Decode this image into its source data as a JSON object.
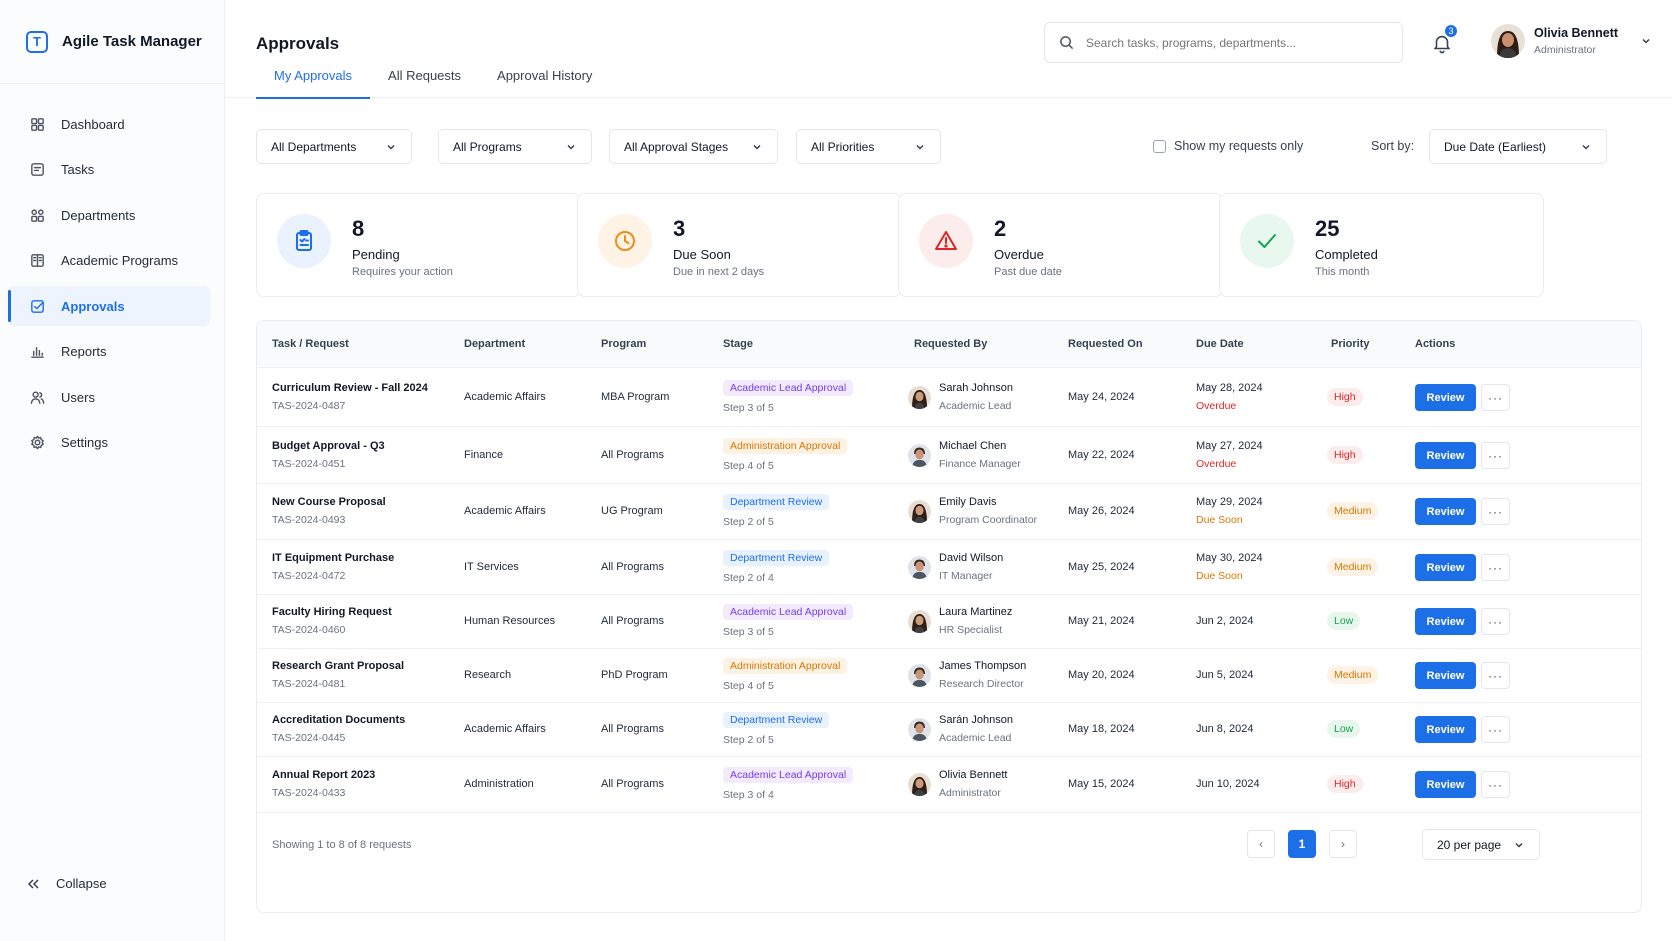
{
  "app": {
    "name": "Agile Task Manager",
    "logo_letter": "T"
  },
  "sidebar": {
    "items": [
      {
        "label": "Dashboard",
        "icon": "dashboard-icon"
      },
      {
        "label": "Tasks",
        "icon": "tasks-icon"
      },
      {
        "label": "Departments",
        "icon": "departments-icon"
      },
      {
        "label": "Academic Programs",
        "icon": "academic-programs-icon"
      },
      {
        "label": "Approvals",
        "icon": "approvals-icon",
        "active": true
      },
      {
        "label": "Reports",
        "icon": "reports-icon"
      },
      {
        "label": "Users",
        "icon": "users-icon"
      },
      {
        "label": "Settings",
        "icon": "settings-icon"
      }
    ],
    "collapse_label": "Collapse"
  },
  "header": {
    "title": "Approvals",
    "tabs": [
      "My Approvals",
      "All Requests",
      "Approval History"
    ],
    "active_tab": 0,
    "search_placeholder": "Search tasks, programs, departments...",
    "notification_count": "3",
    "user": {
      "name": "Olivia Bennett",
      "role": "Administrator"
    }
  },
  "filters": {
    "departments": "All Departments",
    "programs": "All Programs",
    "stages": "All Approval Stages",
    "priorities": "All Priorities",
    "show_mine_label": "Show my requests only",
    "show_mine_checked": false,
    "sort_label": "Sort by:",
    "sort_value": "Due Date (Earliest)"
  },
  "stats": [
    {
      "value": "8",
      "title": "Pending",
      "sub": "Requires your action",
      "icon": "clipboard-icon",
      "color": "#1d6fe8",
      "bg": "#eaf2fe"
    },
    {
      "value": "3",
      "title": "Due Soon",
      "sub": "Due in next 2 days",
      "icon": "clock-icon",
      "color": "#f08c1a",
      "bg": "#fff3e6"
    },
    {
      "value": "2",
      "title": "Overdue",
      "sub": "Past due date",
      "icon": "warning-icon",
      "color": "#dc2626",
      "bg": "#fdecec"
    },
    {
      "value": "25",
      "title": "Completed",
      "sub": "This month",
      "icon": "check-icon",
      "color": "#16a34a",
      "bg": "#e9f8ef"
    }
  ],
  "table": {
    "headers": [
      "Task / Request",
      "Department",
      "Program",
      "Stage",
      "Requested By",
      "Requested On",
      "Due Date",
      "Priority",
      "Actions"
    ],
    "review_label": "Review",
    "more_label": "···",
    "rows": [
      {
        "title": "Curriculum Review - Fall 2024",
        "id": "TAS-2024-0487",
        "department": "Academic Affairs",
        "program": "MBA Program",
        "stage": "Academic Lead Approval",
        "stage_kind": "purple",
        "step": "Step 3 of 5",
        "requester": "Sarah Johnson",
        "requester_role": "Academic Lead",
        "requester_gender": "f",
        "requested_on": "May 24, 2024",
        "due": "May 28, 2024",
        "due_status": "Overdue",
        "due_kind": "overdue",
        "priority": "High"
      },
      {
        "title": "Budget Approval - Q3",
        "id": "TAS-2024-0451",
        "department": "Finance",
        "program": "All Programs",
        "stage": "Administration Approval",
        "stage_kind": "orange",
        "step": "Step 4 of 5",
        "requester": "Michael Chen",
        "requester_role": "Finance Manager",
        "requester_gender": "m",
        "requested_on": "May 22, 2024",
        "due": "May 27, 2024",
        "due_status": "Overdue",
        "due_kind": "overdue",
        "priority": "High"
      },
      {
        "title": "New Course Proposal",
        "id": "TAS-2024-0493",
        "department": "Academic Affairs",
        "program": "UG Program",
        "stage": "Department Review",
        "stage_kind": "blue",
        "step": "Step 2 of 5",
        "requester": "Emily Davis",
        "requester_role": "Program Coordinator",
        "requester_gender": "f",
        "requested_on": "May 26, 2024",
        "due": "May 29, 2024",
        "due_status": "Due Soon",
        "due_kind": "soon",
        "priority": "Medium"
      },
      {
        "title": "IT Equipment Purchase",
        "id": "TAS-2024-0472",
        "department": "IT Services",
        "program": "All Programs",
        "stage": "Department Review",
        "stage_kind": "blue",
        "step": "Step 2 of 4",
        "requester": "David Wilson",
        "requester_role": "IT Manager",
        "requester_gender": "m",
        "requested_on": "May 25, 2024",
        "due": "May 30, 2024",
        "due_status": "Due Soon",
        "due_kind": "soon",
        "priority": "Medium"
      },
      {
        "title": "Faculty Hiring Request",
        "id": "TAS-2024-0460",
        "department": "Human Resources",
        "program": "All Programs",
        "stage": "Academic Lead Approval",
        "stage_kind": "purple",
        "step": "Step 3 of 5",
        "requester": "Laura Martinez",
        "requester_role": "HR Specialist",
        "requester_gender": "f",
        "requested_on": "May 21, 2024",
        "due": "Jun 2, 2024",
        "due_status": "",
        "due_kind": "",
        "priority": "Low"
      },
      {
        "title": "Research Grant Proposal",
        "id": "TAS-2024-0481",
        "department": "Research",
        "program": "PhD Program",
        "stage": "Administration Approval",
        "stage_kind": "orange",
        "step": "Step 4 of 5",
        "requester": "James Thompson",
        "requester_role": "Research Director",
        "requester_gender": "m",
        "requested_on": "May 20, 2024",
        "due": "Jun 5, 2024",
        "due_status": "",
        "due_kind": "",
        "priority": "Medium"
      },
      {
        "title": "Accreditation Documents",
        "id": "TAS-2024-0445",
        "department": "Academic Affairs",
        "program": "All Programs",
        "stage": "Department Review",
        "stage_kind": "blue",
        "step": "Step 2 of 5",
        "requester": "Sarán Johnson",
        "requester_role": "Academic Lead",
        "requester_gender": "m",
        "requested_on": "May 18, 2024",
        "due": "Jun 8, 2024",
        "due_status": "",
        "due_kind": "",
        "priority": "Low"
      },
      {
        "title": "Annual Report 2023",
        "id": "TAS-2024-0433",
        "department": "Administration",
        "program": "All Programs",
        "stage": "Academic Lead Approval",
        "stage_kind": "purple",
        "step": "Step 3 of 4",
        "requester": "Olivia Bennett",
        "requester_role": "Administrator",
        "requester_gender": "f",
        "requested_on": "May 15, 2024",
        "due": "Jun 10, 2024",
        "due_status": "",
        "due_kind": "",
        "priority": "High"
      }
    ]
  },
  "pagination": {
    "info": "Showing 1 to 8 of 8 requests",
    "current_page": "1",
    "prev": "‹",
    "next": "›",
    "per_page": "20 per page"
  },
  "colors": {
    "accent": "#1d6fe8",
    "stage_purple": {
      "fg": "#7c3aed",
      "bg": "#f1ebfd"
    },
    "stage_orange": {
      "fg": "#d97706",
      "bg": "#fdf1e2"
    },
    "stage_blue": {
      "fg": "#1d6fe8",
      "bg": "#e8f1fe"
    },
    "prio_High": {
      "fg": "#dc2626",
      "bg": "#fdecec"
    },
    "prio_Medium": {
      "fg": "#d97706",
      "bg": "#fdf2e3"
    },
    "prio_Low": {
      "fg": "#16a34a",
      "bg": "#e8f7ee"
    },
    "due_overdue": "#dc2626",
    "due_soon": "#d97706"
  }
}
